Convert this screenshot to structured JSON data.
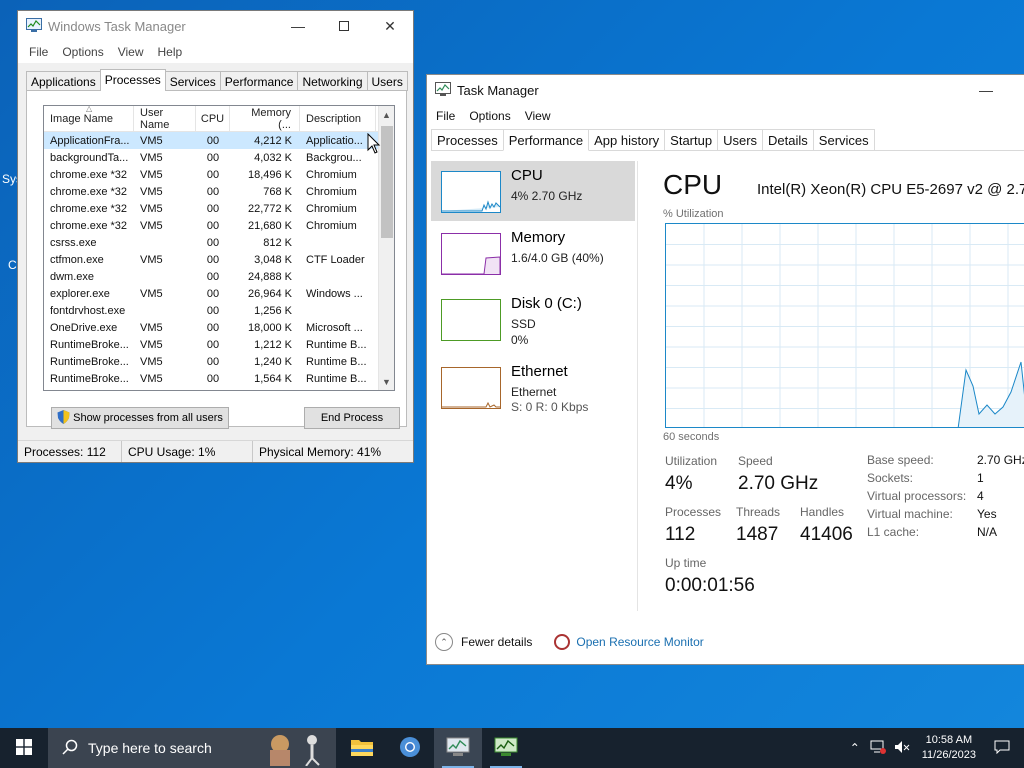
{
  "desktop": {
    "fragments": [
      "Sys",
      "C"
    ]
  },
  "legacy_taskmgr": {
    "title": "Windows Task Manager",
    "menu": [
      "File",
      "Options",
      "View",
      "Help"
    ],
    "tabs": [
      "Applications",
      "Processes",
      "Services",
      "Performance",
      "Networking",
      "Users"
    ],
    "active_tab": "Processes",
    "columns": [
      "Image Name",
      "User Name",
      "CPU",
      "Memory (...",
      "Description"
    ],
    "rows": [
      {
        "image": "ApplicationFra...",
        "user": "VM5",
        "cpu": "00",
        "mem": "4,212 K",
        "desc": "Applicatio..."
      },
      {
        "image": "backgroundTa...",
        "user": "VM5",
        "cpu": "00",
        "mem": "4,032 K",
        "desc": "Backgrou..."
      },
      {
        "image": "chrome.exe *32",
        "user": "VM5",
        "cpu": "00",
        "mem": "18,496 K",
        "desc": "Chromium"
      },
      {
        "image": "chrome.exe *32",
        "user": "VM5",
        "cpu": "00",
        "mem": "768 K",
        "desc": "Chromium"
      },
      {
        "image": "chrome.exe *32",
        "user": "VM5",
        "cpu": "00",
        "mem": "22,772 K",
        "desc": "Chromium"
      },
      {
        "image": "chrome.exe *32",
        "user": "VM5",
        "cpu": "00",
        "mem": "21,680 K",
        "desc": "Chromium"
      },
      {
        "image": "csrss.exe",
        "user": "",
        "cpu": "00",
        "mem": "812 K",
        "desc": ""
      },
      {
        "image": "ctfmon.exe",
        "user": "VM5",
        "cpu": "00",
        "mem": "3,048 K",
        "desc": "CTF Loader"
      },
      {
        "image": "dwm.exe",
        "user": "",
        "cpu": "00",
        "mem": "24,888 K",
        "desc": ""
      },
      {
        "image": "explorer.exe",
        "user": "VM5",
        "cpu": "00",
        "mem": "26,964 K",
        "desc": "Windows ..."
      },
      {
        "image": "fontdrvhost.exe",
        "user": "",
        "cpu": "00",
        "mem": "1,256 K",
        "desc": ""
      },
      {
        "image": "OneDrive.exe",
        "user": "VM5",
        "cpu": "00",
        "mem": "18,000 K",
        "desc": "Microsoft ..."
      },
      {
        "image": "RuntimeBroke...",
        "user": "VM5",
        "cpu": "00",
        "mem": "1,212 K",
        "desc": "Runtime B..."
      },
      {
        "image": "RuntimeBroke...",
        "user": "VM5",
        "cpu": "00",
        "mem": "1,240 K",
        "desc": "Runtime B..."
      },
      {
        "image": "RuntimeBroke...",
        "user": "VM5",
        "cpu": "00",
        "mem": "1,564 K",
        "desc": "Runtime B..."
      }
    ],
    "show_all_label": "Show processes from all users",
    "end_process_label": "End Process",
    "status": {
      "processes": "Processes: 112",
      "cpu": "CPU Usage: 1%",
      "memory": "Physical Memory: 41%"
    }
  },
  "modern_taskmgr": {
    "title": "Task Manager",
    "menu": [
      "File",
      "Options",
      "View"
    ],
    "tabs": [
      "Processes",
      "Performance",
      "App history",
      "Startup",
      "Users",
      "Details",
      "Services"
    ],
    "active_tab": "Performance",
    "side": [
      {
        "title": "CPU",
        "sub1": "4% 2.70 GHz",
        "sub2": "",
        "color": "#1c88c8"
      },
      {
        "title": "Memory",
        "sub1": "1.6/4.0 GB (40%)",
        "sub2": "",
        "color": "#8b2fa8"
      },
      {
        "title": "Disk 0 (C:)",
        "sub1": "SSD",
        "sub2": "0%",
        "color": "#4d9b25"
      },
      {
        "title": "Ethernet",
        "sub1": "Ethernet",
        "sub2": "S: 0 R: 0 Kbps",
        "color": "#a7662b"
      }
    ],
    "cpu_title": "CPU",
    "cpu_model": "Intel(R) Xeon(R) CPU E5-2697 v2 @ 2.7",
    "util_label": "% Utilization",
    "seconds_label": "60 seconds",
    "stats": {
      "utilization_label": "Utilization",
      "utilization": "4%",
      "speed_label": "Speed",
      "speed": "2.70 GHz",
      "processes_label": "Processes",
      "processes": "112",
      "threads_label": "Threads",
      "threads": "1487",
      "handles_label": "Handles",
      "handles": "41406",
      "uptime_label": "Up time",
      "uptime": "0:00:01:56"
    },
    "specs": [
      {
        "label": "Base speed:",
        "value": "2.70 GHz"
      },
      {
        "label": "Sockets:",
        "value": "1"
      },
      {
        "label": "Virtual processors:",
        "value": "4"
      },
      {
        "label": "Virtual machine:",
        "value": "Yes"
      },
      {
        "label": "L1 cache:",
        "value": "N/A"
      }
    ],
    "fewer_details": "Fewer details",
    "open_resmon": "Open Resource Monitor"
  },
  "taskbar": {
    "search_placeholder": "Type here to search",
    "time": "10:58 AM",
    "date": "11/26/2023"
  }
}
